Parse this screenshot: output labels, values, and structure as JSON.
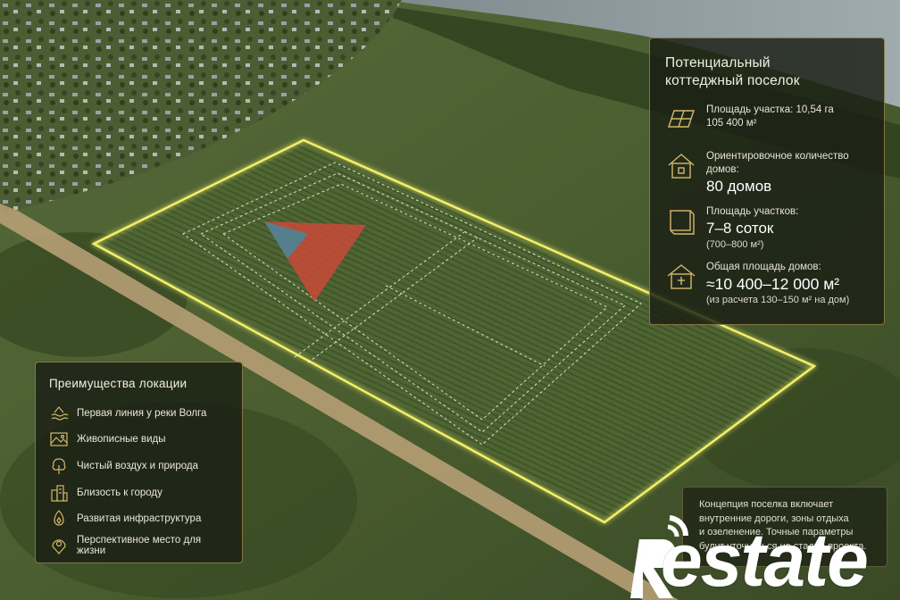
{
  "info_panel": {
    "title_line1": "Потенциальный",
    "title_line2": "коттеджный поселок",
    "stats": [
      {
        "icon": "plot-area-icon",
        "label": "Площадь участка: 10,54 га",
        "value": "105 400 м²"
      },
      {
        "icon": "house-icon",
        "label": "Ориентировочное количество домов:",
        "value": "80 домов"
      },
      {
        "icon": "land-plot-icon",
        "label": "Площадь участков:",
        "value": "7–8 соток",
        "note": "(700–800 м²)"
      },
      {
        "icon": "floor-area-icon",
        "label": "Общая площадь домов:",
        "value": "≈10 400–12 000 м²",
        "note": "(из расчета 130–150 м² на дом)"
      }
    ]
  },
  "advantages_panel": {
    "title": "Преимущества локации",
    "items": [
      {
        "icon": "river-icon",
        "label": "Первая линия у реки Волга"
      },
      {
        "icon": "landscape-icon",
        "label": "Живописные виды"
      },
      {
        "icon": "tree-icon",
        "label": "Чистый воздух и природа"
      },
      {
        "icon": "city-icon",
        "label": "Близость к городу"
      },
      {
        "icon": "infrastructure-icon",
        "label": "Развитая инфраструктура"
      },
      {
        "icon": "location-icon",
        "label": "Перспективное место для жизни"
      }
    ]
  },
  "note_panel": {
    "lines": [
      "Концепция поселка включает",
      "внутренние дороги, зоны отдыха",
      "и озеленение. Точные параметры",
      "будут уточняться на стадии проекта."
    ]
  },
  "watermark": {
    "text": "estate"
  },
  "colors": {
    "accent": "#d4b86e",
    "outline": "#f2f06a",
    "panel_bg": "#1a1e14"
  }
}
